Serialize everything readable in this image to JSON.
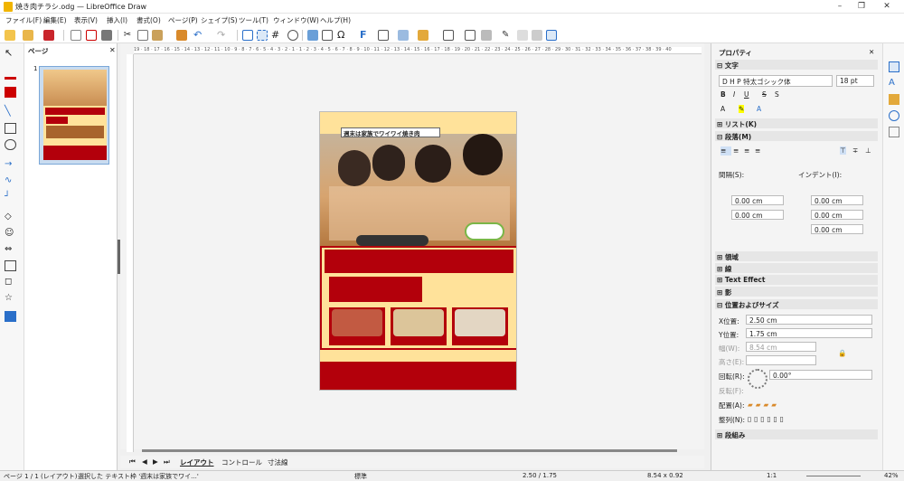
{
  "window": {
    "title": "焼き肉チラシ.odg — LibreOffice Draw",
    "min_icon": "minimize-icon",
    "max_icon": "maximize-icon",
    "close_icon": "close-icon"
  },
  "menu": [
    "ファイル(F)",
    "編集(E)",
    "表示(V)",
    "挿入(I)",
    "書式(O)",
    "ページ(P)",
    "シェイプ(S)",
    "ツール(T)",
    "ウィンドウ(W)",
    "ヘルプ(H)"
  ],
  "pages_panel": {
    "title": "ページ",
    "page_number": "1"
  },
  "canvas": {
    "headline": "週末は家族でワイワイ焼き肉",
    "ruler_ticks": "19 · 18 · 17 · 16 · 15 · 14 · 13 · 12 · 11 · 10 · 9 · 8 · 7 · 6 · 5 · 4 · 3 · 2 · 1 · 1 · 2 · 3 · 4 · 5 · 6 · 7 · 8 · 9 · 10 · 11 · 12 · 13 · 14 · 15 · 16 · 17 · 18 · 19 · 20 · 21 · 22 · 23 · 24 · 25 · 26 · 27 · 28 · 29 · 30 · 31 · 32 · 33 · 34 · 35 · 36 · 37 · 38 · 39 · 40"
  },
  "tabs": [
    "レイアウト",
    "コントロール",
    "寸法線"
  ],
  "sidebar": {
    "title": "プロパティ",
    "sec_character": "文字",
    "font_name": "D H P 特太ゴシック体",
    "font_size": "18 pt",
    "sec_list": "リスト(K)",
    "sec_paragraph": "段落(M)",
    "spacing_label": "間隔(S):",
    "indent_label": "インデント(I):",
    "sp_above": "0.00 cm",
    "sp_below": "0.00 cm",
    "ind_before": "0.00 cm",
    "ind_after": "0.00 cm",
    "ind_first": "0.00 cm",
    "sec_area": "領域",
    "sec_line": "線",
    "sec_text_effect": "Text Effect",
    "sec_shadow": "影",
    "sec_position": "位置およびサイズ",
    "x_label": "X位置:",
    "x_value": "2.50 cm",
    "y_label": "Y位置:",
    "y_value": "1.75 cm",
    "w_label": "幅(W):",
    "w_value": "8.54 cm",
    "h_label": "高さ(E):",
    "rot_label": "回転(R):",
    "rot_value": "0.00°",
    "flip_label": "反転(F):",
    "arrange_label": "配置(A):",
    "align_label": "整列(N):",
    "sec_columns": "段組み"
  },
  "status": {
    "page": "ページ 1 / 1 (レイアウト)",
    "selection": "選択した テキスト枠 '週末は家族でワイ...'",
    "style": "標準",
    "position": "2.50 / 1.75",
    "size": "8.54 x 0.92",
    "scale": "1:1",
    "zoom": "42%"
  },
  "colors": {
    "accent": "#2a6fc9",
    "poster_red": "#b3000b",
    "poster_yellow": "#ffe29a"
  }
}
